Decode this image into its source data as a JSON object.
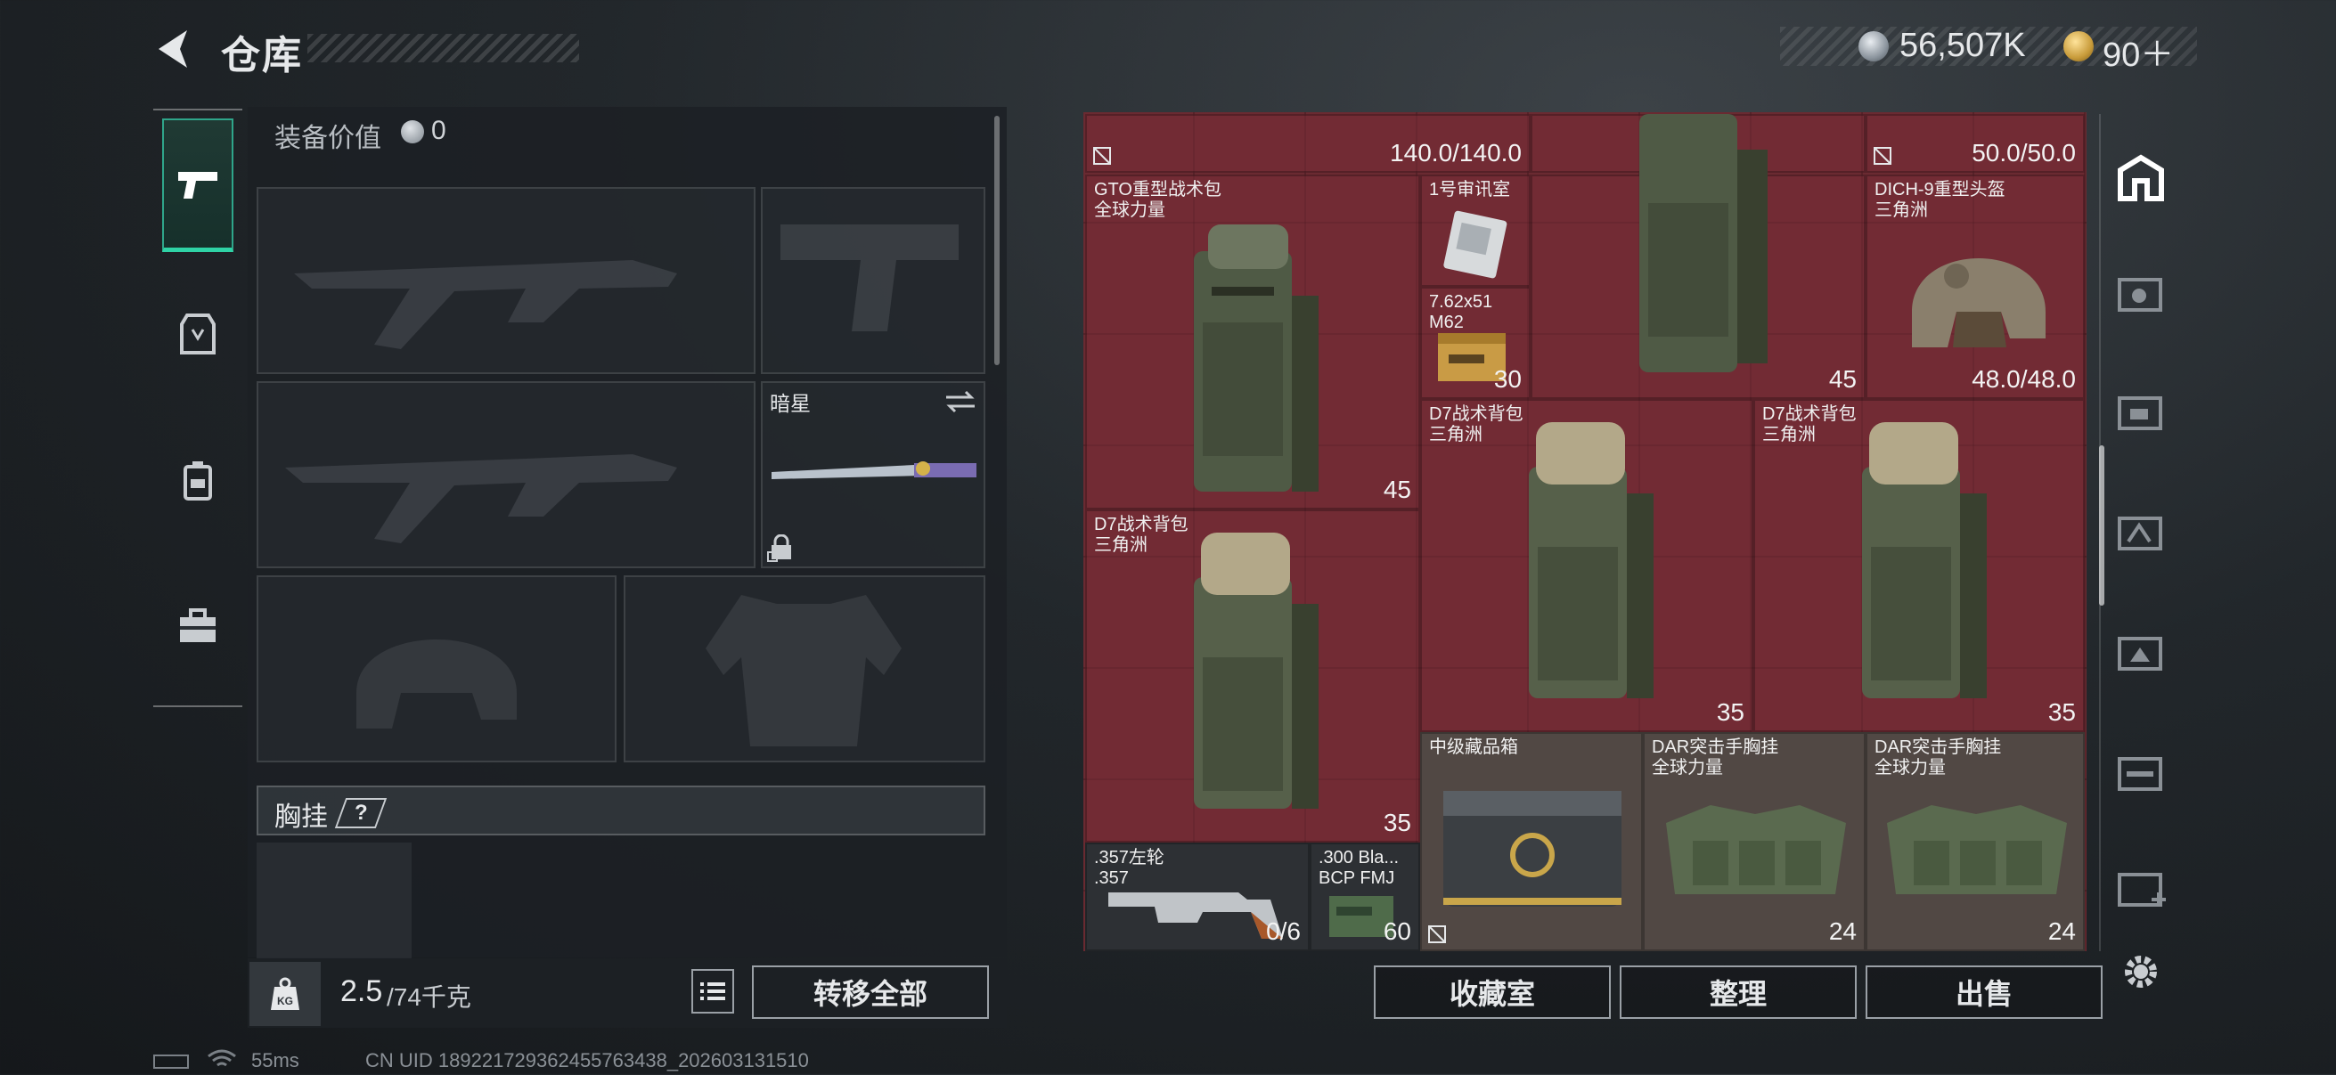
{
  "header": {
    "title": "仓库",
    "currency_coins": "56,507K",
    "currency_tokens": "90＋"
  },
  "gear": {
    "value_label": "装备价值",
    "value_amount": "0",
    "melee_name": "暗星",
    "chest_label": "胸挂",
    "chest_help": "?"
  },
  "weight": {
    "current": "2.5",
    "max": "/74千克",
    "unit_icon": "KG"
  },
  "buttons": {
    "transfer_all": "转移全部",
    "collection_room": "收藏室",
    "sort": "整理",
    "sell": "出售"
  },
  "storage_items": [
    {
      "id": "top-left-count",
      "text": "140.0/140.0"
    },
    {
      "id": "top-right-count",
      "text": "50.0/50.0"
    },
    {
      "id": "gto-bag",
      "name": "GTO重型战术包\n全球力量",
      "count": "45"
    },
    {
      "id": "room1",
      "name": "1号审讯室"
    },
    {
      "id": "ammo762",
      "name": "7.62x51\nM62",
      "count": "30"
    },
    {
      "id": "big-bag-top",
      "count": "45"
    },
    {
      "id": "helmet",
      "name": "DICH-9重型头盔\n三角洲",
      "count": "48.0/48.0"
    },
    {
      "id": "d7-a",
      "name": "D7战术背包\n三角洲",
      "count": "35"
    },
    {
      "id": "d7-b",
      "name": "D7战术背包\n三角洲",
      "count": "35"
    },
    {
      "id": "d7-c",
      "name": "D7战术背包\n三角洲",
      "count": "35"
    },
    {
      "id": "revolver",
      "name": ".357左轮\n.357",
      "count": "0/6"
    },
    {
      "id": "ammo300",
      "name": ".300 Bla...\nBCP FMJ",
      "count": "60"
    },
    {
      "id": "case",
      "name": "中级藏品箱"
    },
    {
      "id": "rig-a",
      "name": "DAR突击手胸挂\n全球力量",
      "count": "24"
    },
    {
      "id": "rig-b",
      "name": "DAR突击手胸挂\n全球力量",
      "count": "24"
    }
  ],
  "status": {
    "ping": "55ms",
    "uid": "CN UID 18922172936245576343​8_202603131510"
  },
  "colors": {
    "accent": "#2fd3a6",
    "storage_bg": "#6a2a31",
    "panel": "#1c2024"
  },
  "icons": {
    "back": "back-arrow-icon",
    "nav": [
      "pistol-icon",
      "vest-icon",
      "backpack-icon",
      "toolbox-icon"
    ]
  }
}
